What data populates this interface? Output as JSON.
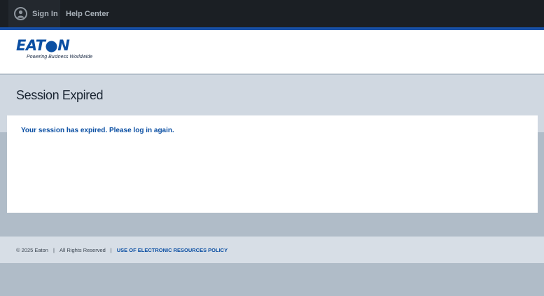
{
  "topnav": {
    "signin_label": "Sign In",
    "help_label": "Help Center",
    "user_icon": "user-icon"
  },
  "header": {
    "logo_text": "EAT●N",
    "logo_tagline": "Powering Business Worldwide"
  },
  "page": {
    "title": "Session Expired",
    "message": "Your session has expired. Please log in again."
  },
  "footer": {
    "copyright": "© 2025 Eaton",
    "sep1": "|",
    "rights": "All Rights Reserved",
    "sep2": "|",
    "policy_link": "USE OF ELECTRONIC RESOURCES POLICY"
  },
  "colors": {
    "brand_blue": "#0b4fa3",
    "topbar": "#1b1f24",
    "accent_bar": "#1950a6"
  }
}
